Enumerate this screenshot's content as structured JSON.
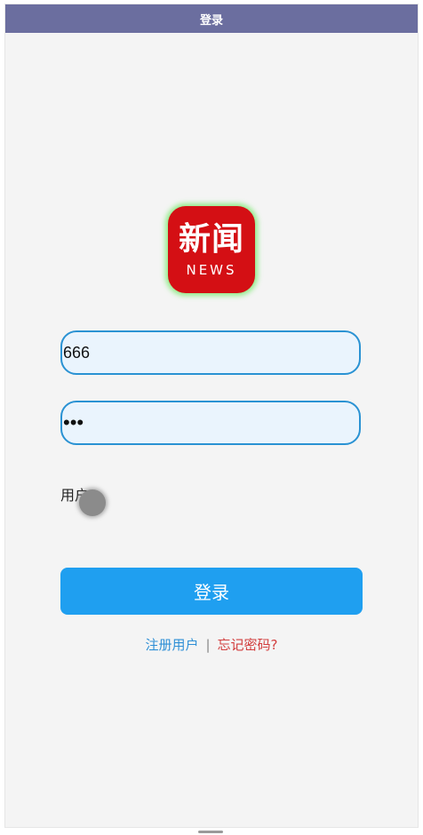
{
  "header": {
    "title": "登录"
  },
  "logo": {
    "main": "新闻",
    "sub": "NEWS"
  },
  "form": {
    "username_value": "666",
    "password_value": "•••",
    "role_label": "用户"
  },
  "actions": {
    "login_label": "登录",
    "register_link": "注册用户",
    "separator": "|",
    "forgot_link": "忘记密码?"
  },
  "colors": {
    "header_bg": "#6b6e9f",
    "logo_bg": "#d40f14",
    "primary_button": "#1f9ff0",
    "input_border": "#2a92d3",
    "register_link": "#2e8fd6",
    "forgot_link": "#d23e3e"
  }
}
